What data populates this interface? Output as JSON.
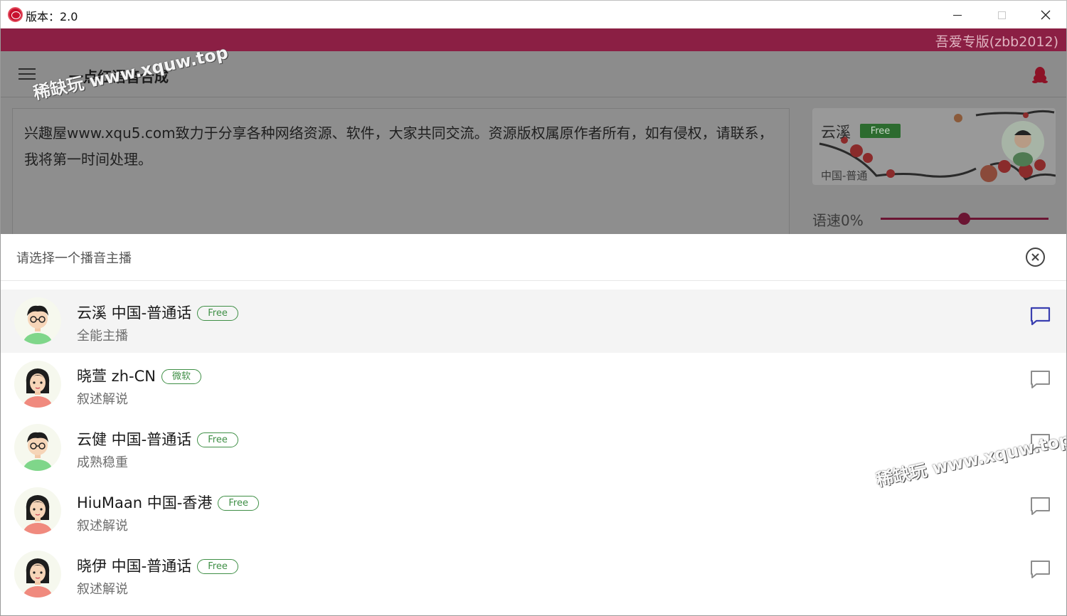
{
  "window": {
    "title": "版本：2.0",
    "minimize_icon": "minimize-icon",
    "maximize_icon": "maximize-icon",
    "close_icon": "close-icon"
  },
  "banner": {
    "text": "吾爱专版(zbb2012)",
    "color": "#8b1f44"
  },
  "appbar": {
    "menu_icon": "hamburger-menu-icon",
    "title": "一点红语音合成",
    "qq_icon": "qq-penguin-icon",
    "accent": "#c8102e"
  },
  "editor": {
    "text": "兴趣屋www.xqu5.com致力于分享各种网络资源、软件，大家共同交流。资源版权属原作者所有，如有侵权，请联系，我将第一时间处理。"
  },
  "voice_card": {
    "name": "云溪",
    "badge": "Free",
    "language": "中国-普通"
  },
  "speed": {
    "label": "语速0%",
    "value_fraction": 0.5
  },
  "watermarks": [
    "稀缺玩 www.xquw.top",
    "稀缺玩 www.xquw.top"
  ],
  "sheet": {
    "title": "请选择一个播音主播",
    "close_icon": "close-circle-icon",
    "items": [
      {
        "name": "云溪 中国-普通话",
        "tag": "Free",
        "desc": "全能主播",
        "avatar": "male-avatar-icon",
        "selected": true
      },
      {
        "name": "晓萱 zh-CN",
        "tag": "微软",
        "desc": "叙述解说",
        "avatar": "female-avatar-icon",
        "selected": false
      },
      {
        "name": "云健 中国-普通话",
        "tag": "Free",
        "desc": "成熟稳重",
        "avatar": "male-avatar-icon",
        "selected": false
      },
      {
        "name": "HiuMaan 中国-香港",
        "tag": "Free",
        "desc": "叙述解说",
        "avatar": "female-avatar-icon",
        "selected": false
      },
      {
        "name": "晓伊 中国-普通话",
        "tag": "Free",
        "desc": "叙述解说",
        "avatar": "female-avatar-icon",
        "selected": false
      }
    ],
    "selected_icon_color": "#3a3fb0",
    "tag_color": "#3f8f46"
  }
}
